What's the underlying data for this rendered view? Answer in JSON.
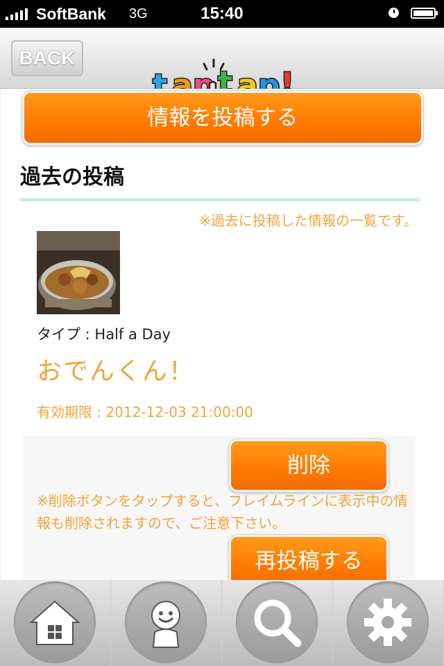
{
  "status_bar": {
    "carrier": "SoftBank",
    "network": "3G",
    "time": "15:40"
  },
  "navbar": {
    "back_label": "BACK",
    "logo_text": "taptap!"
  },
  "main": {
    "post_button_label": "情報を投稿する",
    "section_title": "過去の投稿",
    "list_note": "※過去に投稿した情報の一覧です。",
    "post": {
      "type_label": "タイプ : Half a Day",
      "title": "おでんくん！",
      "expiry": "有効期限 : 2012-12-03 21:00:00",
      "delete_label": "削除",
      "delete_warning": "※削除ボタンをタップすると、フレイムラインに表示中の情報も削除されますので、ご注意下さい。",
      "repost_label": "再投稿する"
    }
  },
  "tab_bar": {
    "items": [
      {
        "icon": "home-icon"
      },
      {
        "icon": "profile-icon"
      },
      {
        "icon": "search-icon"
      },
      {
        "icon": "gear-icon"
      }
    ]
  },
  "colors": {
    "accent_orange": "#ff7f00",
    "note_orange": "#f0a43c",
    "divider_mint": "#bdeedd"
  }
}
